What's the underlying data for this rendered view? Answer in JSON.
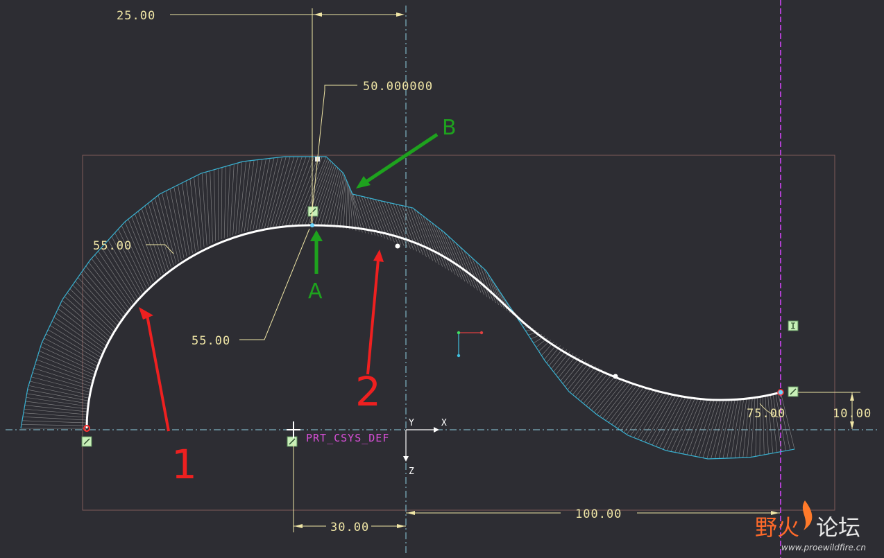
{
  "dimensions": {
    "d25": "25.00",
    "d50": "50.000000",
    "d55_top": "55.00",
    "d55_mid": "55.00",
    "d30": "30.00",
    "d100": "100.00",
    "d75": "75.00",
    "d10": "10.00"
  },
  "csys": {
    "label": "PRT_CSYS_DEF",
    "axis_y": "Y",
    "axis_x": "X",
    "axis_z": "Z"
  },
  "annotations": {
    "red_1": "1",
    "red_2": "2",
    "green_a": "A",
    "green_b": "B"
  },
  "watermark": {
    "title_part1": "野火",
    "title_part2": "论坛",
    "url": "www.proewildfire.cn"
  },
  "colors": {
    "background": "#2d2d33",
    "curve": "#ffffff",
    "comb": "#39b3d3",
    "dimension": "#f0e6a6",
    "centerline_vertical": "#b040d0",
    "note_red": "#ee2020",
    "note_green": "#1ea21e"
  }
}
